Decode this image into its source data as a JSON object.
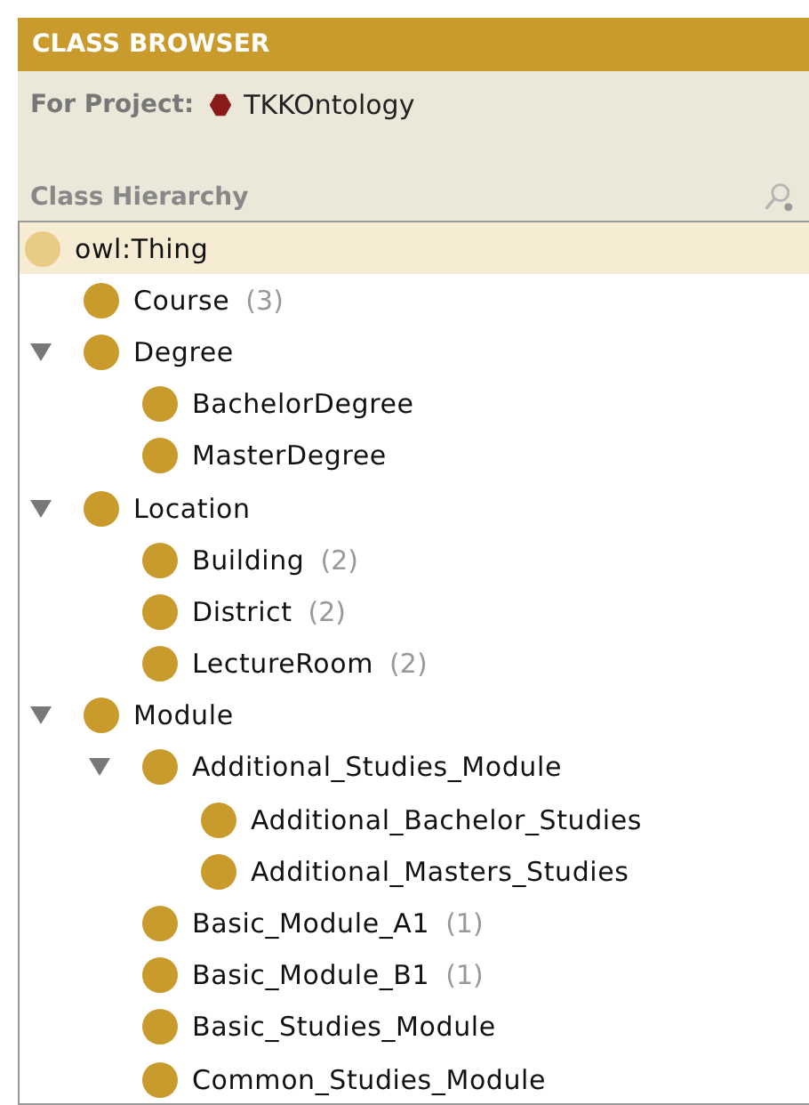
{
  "panel": {
    "title": "CLASS BROWSER"
  },
  "project": {
    "label": "For Project:",
    "name": "TKKOntology"
  },
  "hierarchy": {
    "title": "Class Hierarchy",
    "root": {
      "label": "owl:Thing",
      "selected": true,
      "children": [
        {
          "label": "Course",
          "count": "(3)",
          "selected": false
        },
        {
          "label": "Degree",
          "selected": false,
          "expanded": true,
          "children": [
            {
              "label": "BachelorDegree",
              "selected": false
            },
            {
              "label": "MasterDegree",
              "selected": false
            }
          ]
        },
        {
          "label": "Location",
          "selected": false,
          "expanded": true,
          "children": [
            {
              "label": "Building",
              "count": "(2)",
              "selected": false
            },
            {
              "label": "District",
              "count": "(2)",
              "selected": false
            },
            {
              "label": "LectureRoom",
              "count": "(2)",
              "selected": false
            }
          ]
        },
        {
          "label": "Module",
          "selected": false,
          "expanded": true,
          "children": [
            {
              "label": "Additional_Studies_Module",
              "selected": false,
              "expanded": true,
              "children": [
                {
                  "label": "Additional_Bachelor_Studies",
                  "selected": false
                },
                {
                  "label": "Additional_Masters_Studies",
                  "selected": false
                }
              ]
            },
            {
              "label": "Basic_Module_A1",
              "count": "(1)",
              "selected": false
            },
            {
              "label": "Basic_Module_B1",
              "count": "(1)",
              "selected": false
            },
            {
              "label": "Basic_Studies_Module",
              "selected": false
            },
            {
              "label": "Common_Studies_Module",
              "selected": false
            }
          ]
        }
      ]
    }
  }
}
